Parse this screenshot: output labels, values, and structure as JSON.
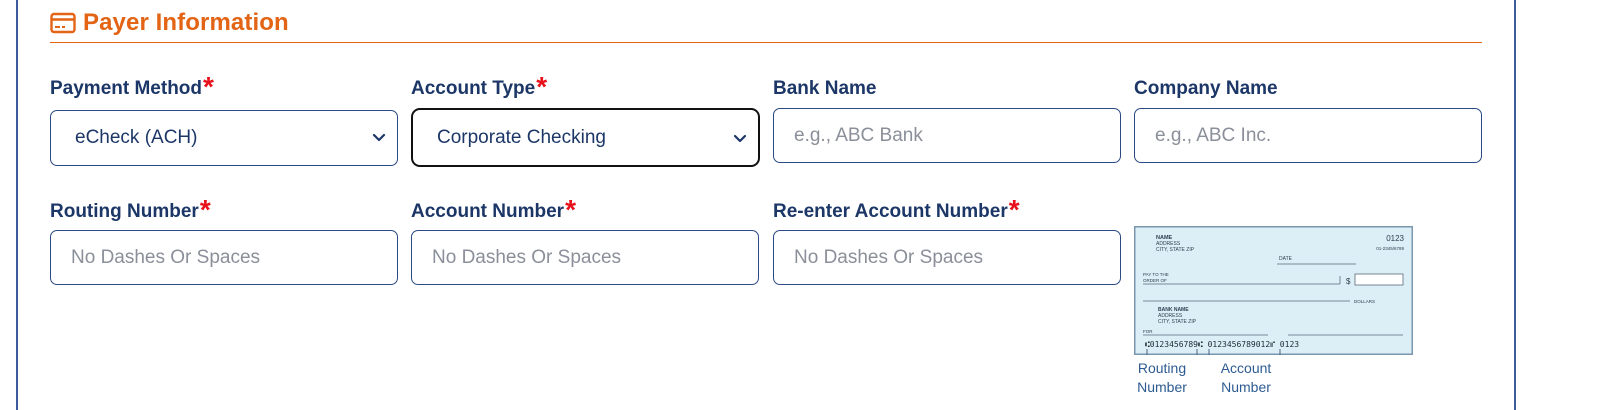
{
  "section": {
    "title": "Payer Information",
    "icon": "credit-card-icon"
  },
  "colors": {
    "accent": "#e36414",
    "label": "#1c3767",
    "required": "#e8101a",
    "border": "#2b4a82"
  },
  "fields": {
    "payment_method": {
      "label": "Payment Method",
      "value": "eCheck (ACH)",
      "required": true
    },
    "account_type": {
      "label": "Account Type",
      "value": "Corporate Checking",
      "required": true
    },
    "bank_name": {
      "label": "Bank Name",
      "placeholder": "e.g., ABC Bank",
      "required": false
    },
    "company_name": {
      "label": "Company Name",
      "placeholder": "e.g., ABC Inc.",
      "required": false
    },
    "routing_number": {
      "label": "Routing Number",
      "placeholder": "No Dashes Or Spaces",
      "required": true
    },
    "account_number": {
      "label": "Account Number",
      "placeholder": "No Dashes Or Spaces",
      "required": true
    },
    "reenter_account_number": {
      "label": "Re-enter Account Number",
      "placeholder": "No Dashes Or Spaces",
      "required": true
    }
  },
  "required_mark": "*",
  "check": {
    "name": "NAME",
    "address": "ADDRESS",
    "city": "CITY, STATE ZIP",
    "number": "0123",
    "fraction": "01-2345/6789",
    "date": "DATE",
    "pay_to_1": "PAY TO THE",
    "pay_to_2": "ORDER OF",
    "dollar_sign": "$",
    "dollars": "DOLLARS",
    "bank_name": "BANK NAME",
    "bank_address": "ADDRESS",
    "bank_city": "CITY, STATE ZIP",
    "for": "FOR",
    "micr": "⑆0123456789⑆ 0123456789012⑈ 0123",
    "routing_caption": [
      "Routing",
      "Number"
    ],
    "account_caption": [
      "Account",
      "Number"
    ]
  }
}
